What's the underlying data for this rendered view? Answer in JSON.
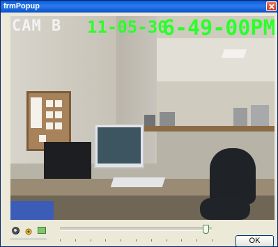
{
  "window": {
    "title": "frmPopup"
  },
  "video": {
    "overlay": {
      "camera": "CAM B",
      "date": "11-05-30",
      "time": "6-49-00PM"
    }
  },
  "controls": {
    "slider_level": 0.96,
    "ok_label": "OK"
  },
  "icons": [
    "speaker-icon",
    "snapshot-icon",
    "record-icon",
    "close-icon"
  ],
  "colors": {
    "osd_green": "#2aff2a",
    "titlebar_blue": "#0a5fd8"
  }
}
